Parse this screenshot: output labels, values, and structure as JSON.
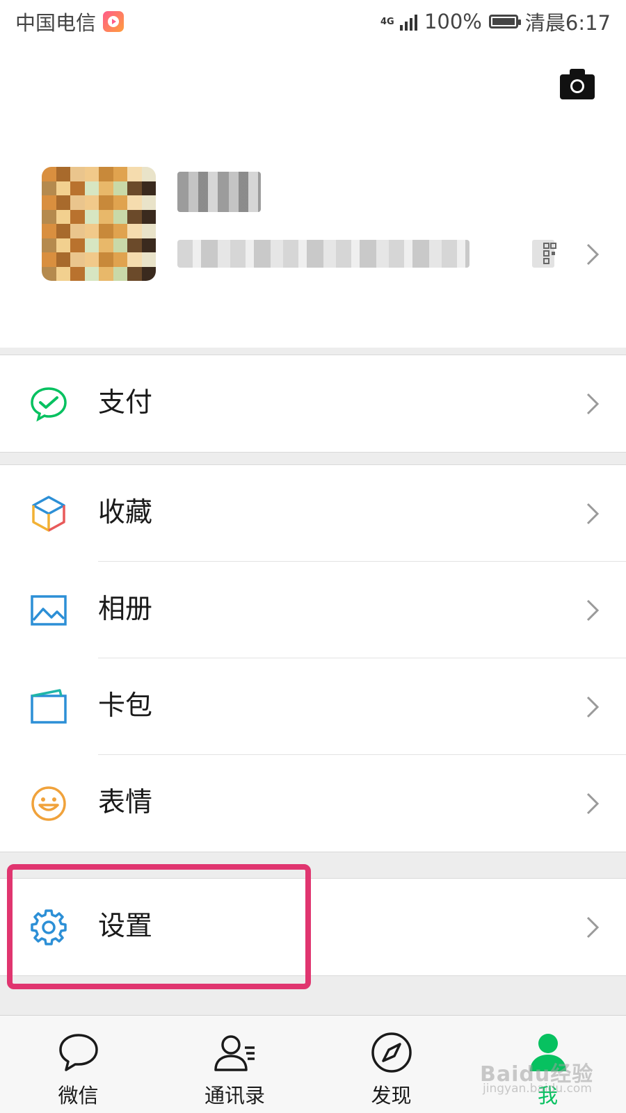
{
  "status_bar": {
    "carrier": "中国电信",
    "network": "4G",
    "battery": "100%",
    "time": "清晨6:17"
  },
  "header": {
    "camera_icon": "camera-icon",
    "qr_icon": "qr-code-icon"
  },
  "menu": {
    "pay": {
      "label": "支付",
      "icon": "wechat-pay-icon",
      "color": "#07c160"
    },
    "favorites": {
      "label": "收藏",
      "icon": "cube-icon"
    },
    "album": {
      "label": "相册",
      "icon": "photo-icon",
      "color": "#2c8fd6"
    },
    "cards": {
      "label": "卡包",
      "icon": "card-wallet-icon",
      "color": "#2c8fd6"
    },
    "stickers": {
      "label": "表情",
      "icon": "smiley-icon",
      "color": "#f0a23b"
    },
    "settings": {
      "label": "设置",
      "icon": "gear-icon",
      "color": "#2c8fd6"
    }
  },
  "tabs": [
    {
      "label": "微信",
      "icon": "chat-bubble-icon"
    },
    {
      "label": "通讯录",
      "icon": "contacts-icon"
    },
    {
      "label": "发现",
      "icon": "compass-icon"
    },
    {
      "label": "我",
      "icon": "person-icon",
      "active": true
    }
  ],
  "accent_color": "#07c160",
  "highlight_color": "#e0356f",
  "watermark": {
    "brand": "Baidu经验",
    "site": "jingyan.baidu.com"
  }
}
